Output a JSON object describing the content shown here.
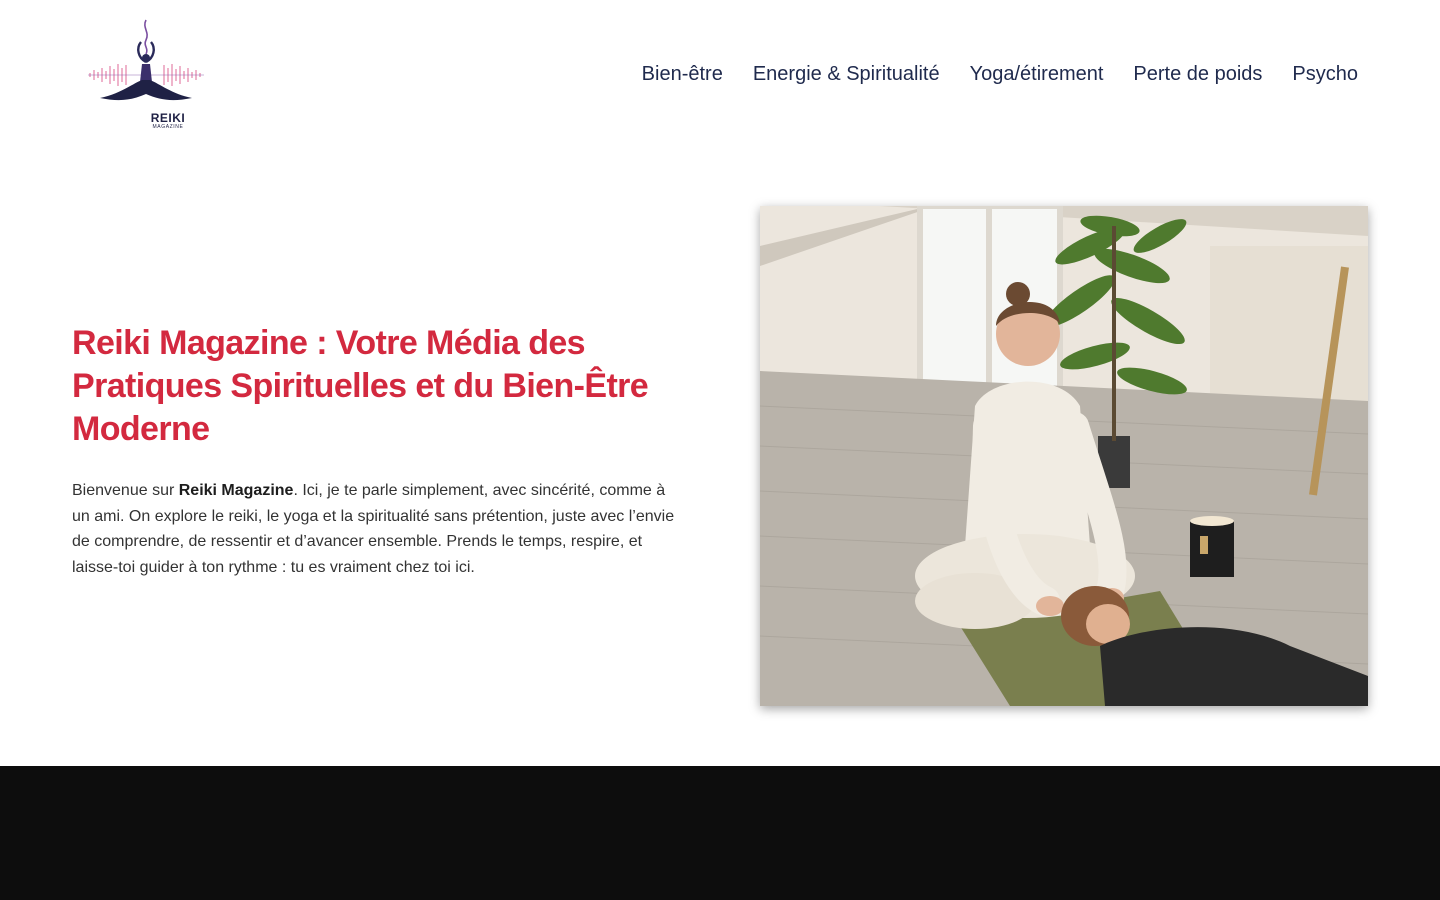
{
  "brand": {
    "logo_word": "REIKI",
    "logo_sub": "MAGAZINE",
    "logo_icon": "meditating-figure-logo",
    "accent_color": "#d3293f",
    "nav_color": "#1f2a4d"
  },
  "nav": {
    "items": [
      {
        "label": "Bien-être"
      },
      {
        "label": "Energie & Spiritualité"
      },
      {
        "label": "Yoga/étirement"
      },
      {
        "label": "Perte de poids"
      },
      {
        "label": "Psycho"
      }
    ]
  },
  "hero": {
    "title": "Reiki Magazine : Votre Média des Pratiques Spirituelles et du Bien-Être Moderne",
    "intro_prefix": "Bienvenue sur ",
    "intro_bold": "Reiki Magazine",
    "intro_rest": ". Ici, je te parle simplement, avec sincérité, comme à un ami. On explore le reiki, le yoga et la spiritualité sans prétention, juste avec l’envie de comprendre, de ressentir et d’avancer ensemble. Prends le temps, respire, et laisse-toi guider à ton rythme : tu es vraiment chez toi ici."
  },
  "footer_band": {
    "color": "#0d0d0d"
  }
}
